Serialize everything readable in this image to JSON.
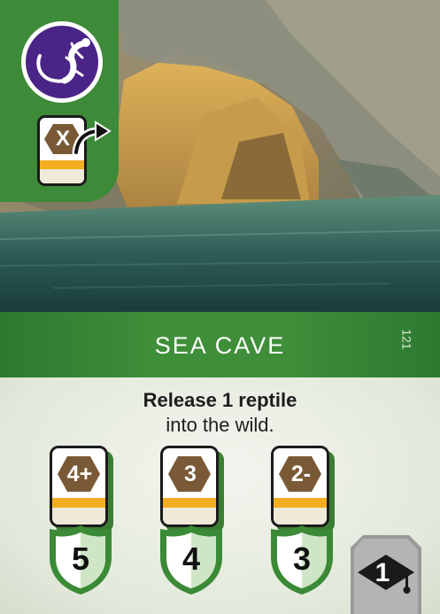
{
  "card": {
    "title": "SEA CAVE",
    "number": "121",
    "category_icon": "reptile-icon",
    "requirement_icon": "release-card-icon",
    "requirement_symbol": "X",
    "effect": {
      "line1": "Release 1 reptile",
      "line2": "into the wild."
    },
    "tiers": [
      {
        "requirement": "4+",
        "reward": "5"
      },
      {
        "requirement": "3",
        "reward": "4"
      },
      {
        "requirement": "2-",
        "reward": "3"
      }
    ],
    "bonus": {
      "icon": "graduation-cap-icon",
      "value": "1"
    },
    "colors": {
      "panel_green": "#3d8a38",
      "title_green": "#3f8e39",
      "reptile_purple": "#4b2487",
      "hex_brown": "#7a5a36",
      "stripe_gold": "#f2ae1f",
      "corner_gray": "#9a9a9a"
    }
  }
}
